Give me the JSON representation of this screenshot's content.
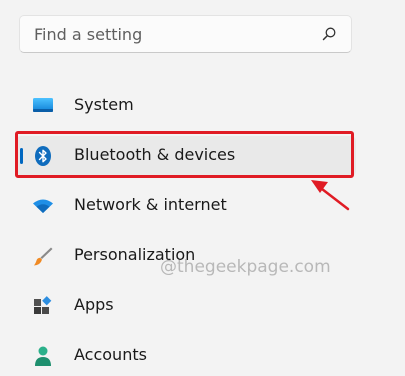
{
  "search": {
    "placeholder": "Find a setting",
    "icon": "search-icon"
  },
  "nav": {
    "items": [
      {
        "label": "System",
        "icon": "display-icon"
      },
      {
        "label": "Bluetooth & devices",
        "icon": "bluetooth-icon",
        "selected": true
      },
      {
        "label": "Network & internet",
        "icon": "wifi-icon"
      },
      {
        "label": "Personalization",
        "icon": "paintbrush-icon"
      },
      {
        "label": "Apps",
        "icon": "apps-icon"
      },
      {
        "label": "Accounts",
        "icon": "account-icon"
      }
    ]
  },
  "watermark": "@thegeekpage.com",
  "colors": {
    "accent": "#0067c0",
    "annotation": "#e01b24",
    "background": "#f3f3f3"
  }
}
